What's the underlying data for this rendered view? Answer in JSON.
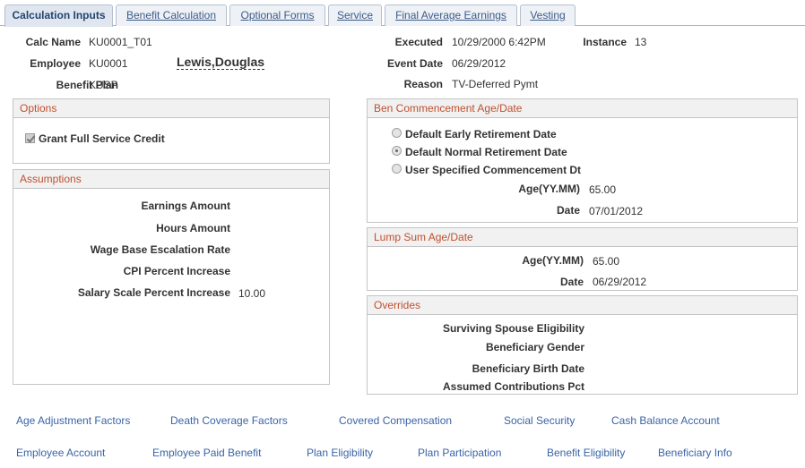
{
  "tabs": [
    {
      "label": "Calculation Inputs",
      "active": true
    },
    {
      "label": "Benefit Calculation",
      "active": false
    },
    {
      "label": "Optional Forms",
      "active": false
    },
    {
      "label": "Service",
      "active": false
    },
    {
      "label": "Final Average Earnings",
      "active": false
    },
    {
      "label": "Vesting",
      "active": false
    }
  ],
  "header": {
    "calc_name_label": "Calc Name",
    "calc_name": "KU0001_T01",
    "employee_label": "Employee",
    "employee_id": "KU0001",
    "employee_name": "Lewis,Douglas",
    "benefit_plan_label": "Benefit Plan",
    "benefit_plan": "KUSP",
    "executed_label": "Executed",
    "executed": "10/29/2000  6:42PM",
    "instance_label": "Instance",
    "instance": "13",
    "event_date_label": "Event Date",
    "event_date": "06/29/2012",
    "reason_label": "Reason",
    "reason": "TV-Deferred Pymt"
  },
  "options": {
    "title": "Options",
    "grant_full_service_credit": "Grant Full Service Credit",
    "grant_full_service_credit_checked": true
  },
  "assumptions": {
    "title": "Assumptions",
    "earnings_amount_label": "Earnings Amount",
    "earnings_amount": "",
    "hours_amount_label": "Hours Amount",
    "hours_amount": "",
    "wage_base_label": "Wage Base Escalation Rate",
    "wage_base": "",
    "cpi_label": "CPI Percent Increase",
    "cpi": "",
    "salary_scale_label": "Salary Scale Percent Increase",
    "salary_scale": "10.00"
  },
  "commencement": {
    "title": "Ben Commencement Age/Date",
    "radio_early": "Default Early Retirement Date",
    "radio_normal": "Default Normal Retirement Date",
    "radio_user": "User Specified Commencement Dt",
    "selected": "normal",
    "age_label": "Age(YY.MM)",
    "age": "65.00",
    "date_label": "Date",
    "date": "07/01/2012"
  },
  "lump_sum": {
    "title": "Lump Sum Age/Date",
    "age_label": "Age(YY.MM)",
    "age": "65.00",
    "date_label": "Date",
    "date": "06/29/2012"
  },
  "overrides": {
    "title": "Overrides",
    "spouse_label": "Surviving Spouse Eligibility",
    "gender_label": "Beneficiary Gender",
    "birth_label": "Beneficiary Birth Date",
    "contrib_label": "Assumed Contributions Pct"
  },
  "links": {
    "row1": [
      "Age Adjustment Factors",
      "Death Coverage Factors",
      "Covered Compensation",
      "Social Security",
      "Cash Balance Account"
    ],
    "row2": [
      "Employee Account",
      "Employee Paid Benefit",
      "Plan Eligibility",
      "Plan Participation",
      "Benefit Eligibility",
      "Beneficiary Info"
    ]
  },
  "colors": {
    "link": "#3a64a8",
    "section_title": "#c0502e",
    "tab_text": "#3b5b8a"
  }
}
